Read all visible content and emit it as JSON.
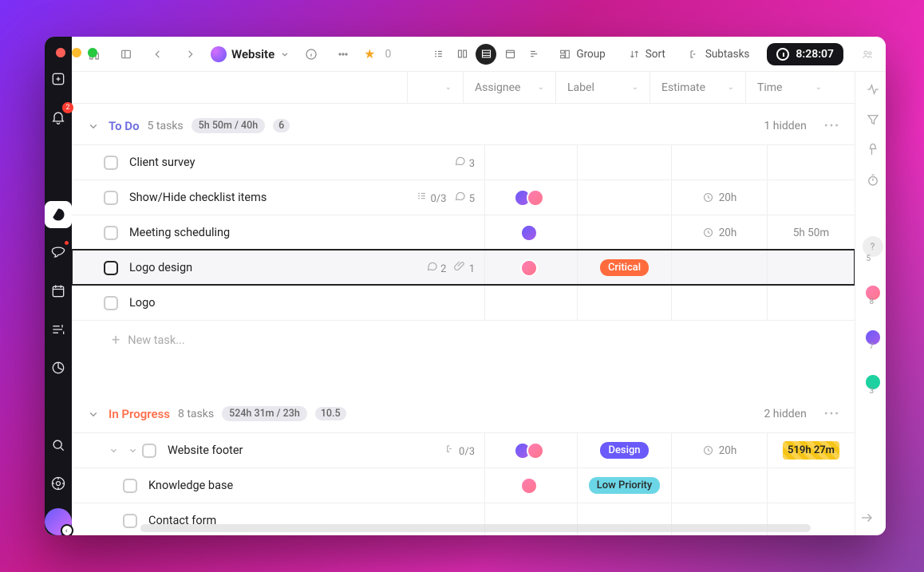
{
  "project": {
    "name": "Website",
    "star_count": "0",
    "timer": "8:28:07"
  },
  "toolbar": {
    "group_label": "Group",
    "sort_label": "Sort",
    "subtasks_label": "Subtasks"
  },
  "sidebar_badges": {
    "notifications": "2"
  },
  "columns": {
    "assignee": "Assignee",
    "label": "Label",
    "estimate": "Estimate",
    "time": "Time"
  },
  "sections": [
    {
      "name": "To Do",
      "color": "#6b6bdf",
      "task_count": "5 tasks",
      "time_pill": "5h 50m / 40h",
      "count_pill": "6",
      "hidden_text": "1 hidden",
      "tasks": [
        {
          "title": "Client survey",
          "comments": "3"
        },
        {
          "title": "Show/Hide checklist items",
          "checklist": "0/3",
          "comments": "5",
          "assignees": [
            "purple",
            "pink"
          ],
          "estimate": "20h"
        },
        {
          "title": "Meeting scheduling",
          "assignees": [
            "purple"
          ],
          "estimate": "20h",
          "time": "5h 50m"
        },
        {
          "title": "Logo design",
          "comments": "2",
          "attachments": "1",
          "assignees": [
            "pink"
          ],
          "label": {
            "text": "Critical",
            "bg": "#ff6b3d"
          },
          "selected": true
        },
        {
          "title": "Logo"
        }
      ],
      "new_task": "New task..."
    },
    {
      "name": "In Progress",
      "color": "#ff704d",
      "task_count": "8 tasks",
      "time_pill": "524h 31m / 23h",
      "count_pill": "10.5",
      "hidden_text": "2 hidden",
      "tasks": [
        {
          "title": "Website footer",
          "expandable": true,
          "checklist": "0/3",
          "assignees": [
            "purple",
            "pink"
          ],
          "label": {
            "text": "Design",
            "bg": "#6a5af9"
          },
          "estimate": "20h",
          "time_over": "519h 27m"
        },
        {
          "title": "Knowledge base",
          "child": true,
          "assignees": [
            "pink"
          ],
          "label": {
            "text": "Low Priority",
            "bg": "#6bd6e6",
            "fg": "#2a2a2a"
          }
        },
        {
          "title": "Contact form",
          "child": true
        }
      ]
    }
  ],
  "rightrail_counts": {
    "q": "5",
    "a1": "8",
    "a2": "7",
    "a3": "3"
  }
}
